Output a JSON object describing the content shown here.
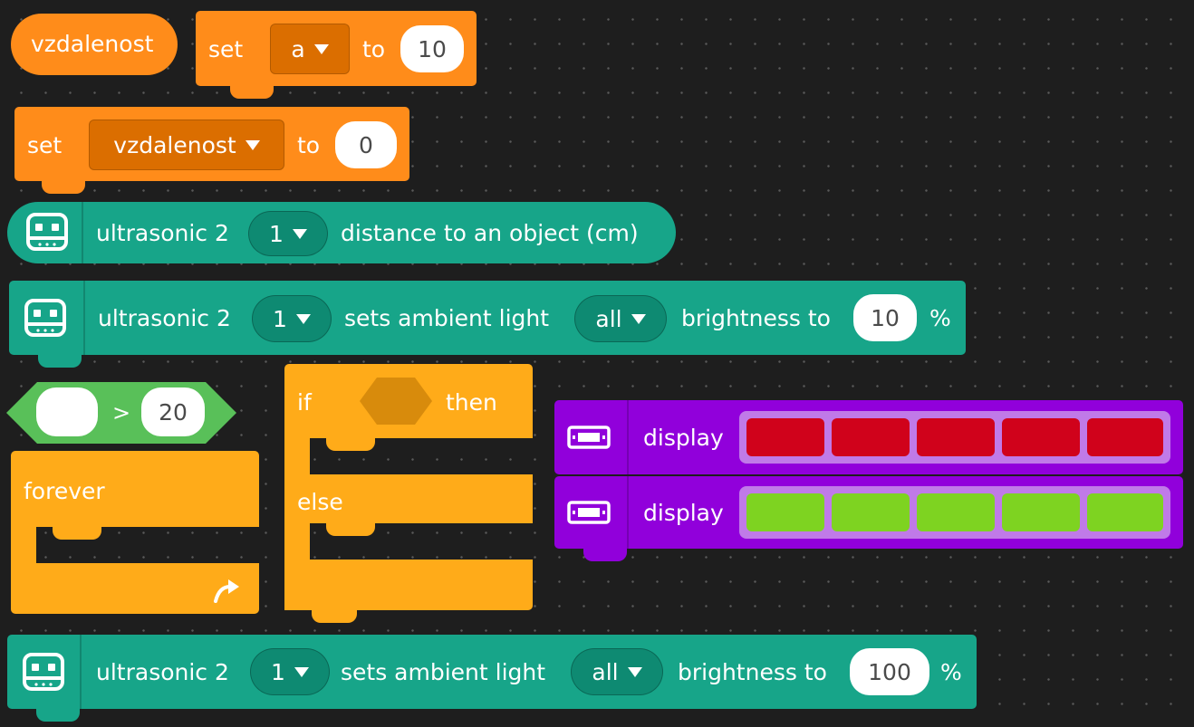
{
  "blocks": {
    "variable_reporter": {
      "label": "vzdalenost"
    },
    "set_a": {
      "set_label": "set",
      "variable": "a",
      "to_label": "to",
      "value": "10"
    },
    "set_vzdalenost": {
      "set_label": "set",
      "variable": "vzdalenost",
      "to_label": "to",
      "value": "0"
    },
    "ultrasonic_distance": {
      "sensor_label": "ultrasonic 2",
      "port": "1",
      "text": "distance to an object (cm)"
    },
    "ultrasonic_light_10": {
      "sensor_label": "ultrasonic 2",
      "port": "1",
      "sets_label": "sets ambient light",
      "target": "all",
      "brightness_label": "brightness to",
      "value": "10",
      "unit": "%"
    },
    "compare": {
      "left_value": "",
      "operator": ">",
      "right_value": "20"
    },
    "forever": {
      "label": "forever"
    },
    "if_else": {
      "if_label": "if",
      "then_label": "then",
      "else_label": "else"
    },
    "display_red": {
      "label": "display",
      "cell_color": "#D0021B",
      "cells": 5
    },
    "display_green": {
      "label": "display",
      "cell_color": "#7ED321",
      "cells": 5
    },
    "ultrasonic_light_100": {
      "sensor_label": "ultrasonic 2",
      "port": "1",
      "sets_label": "sets ambient light",
      "target": "all",
      "brightness_label": "brightness to",
      "value": "100",
      "unit": "%"
    }
  },
  "colors": {
    "variables": "#FF8C1A",
    "control": "#FFAB19",
    "sensor": "#17A589",
    "display": "#9100DB",
    "background": "#1e1e1e"
  },
  "icons": {
    "sensor": "robot-face-icon",
    "display": "led-strip-icon",
    "dropdown": "triangle-down-icon",
    "loop": "loop-arrow-icon"
  }
}
